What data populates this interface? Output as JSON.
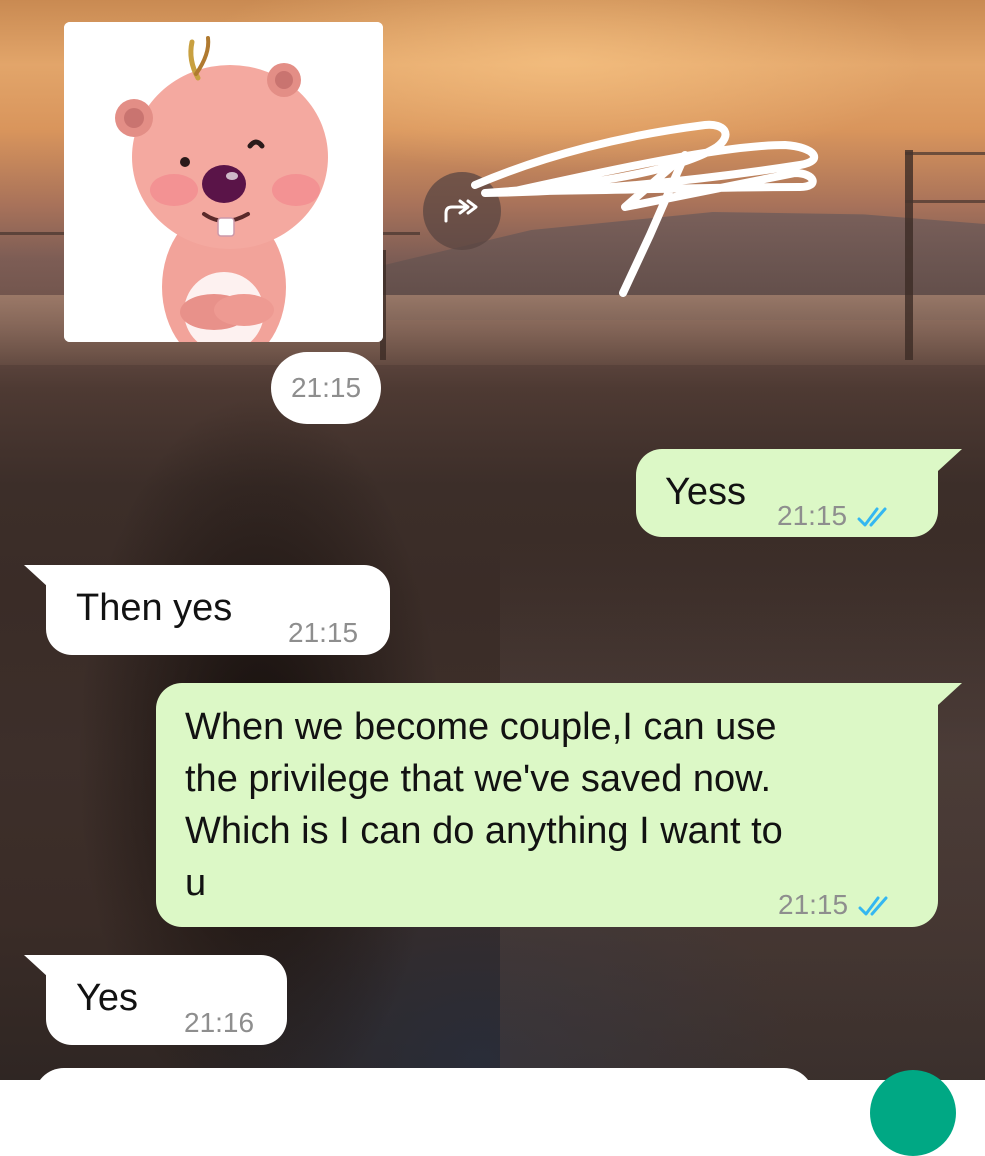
{
  "chat": {
    "sticker": {
      "icon": "pink-beaver-sticker",
      "time": "21:15"
    },
    "forward_icon": "forward-icon",
    "messages": [
      {
        "direction": "outgoing",
        "text": "Yess",
        "time": "21:15",
        "status": "read"
      },
      {
        "direction": "incoming",
        "text": "Then yes",
        "time": "21:15"
      },
      {
        "direction": "outgoing",
        "text": "When we become couple,I can use\nthe privilege that we've saved now.\nWhich is I can do anything I want to\nu",
        "time": "21:15",
        "status": "read"
      },
      {
        "direction": "incoming",
        "text": "Yes",
        "time": "21:16"
      }
    ]
  },
  "colors": {
    "outgoing_bubble": "#dcf8c6",
    "incoming_bubble": "#ffffff",
    "timestamp": "#8e8e8e",
    "read_ticks": "#34b7f1",
    "mic_button": "#00a884"
  }
}
